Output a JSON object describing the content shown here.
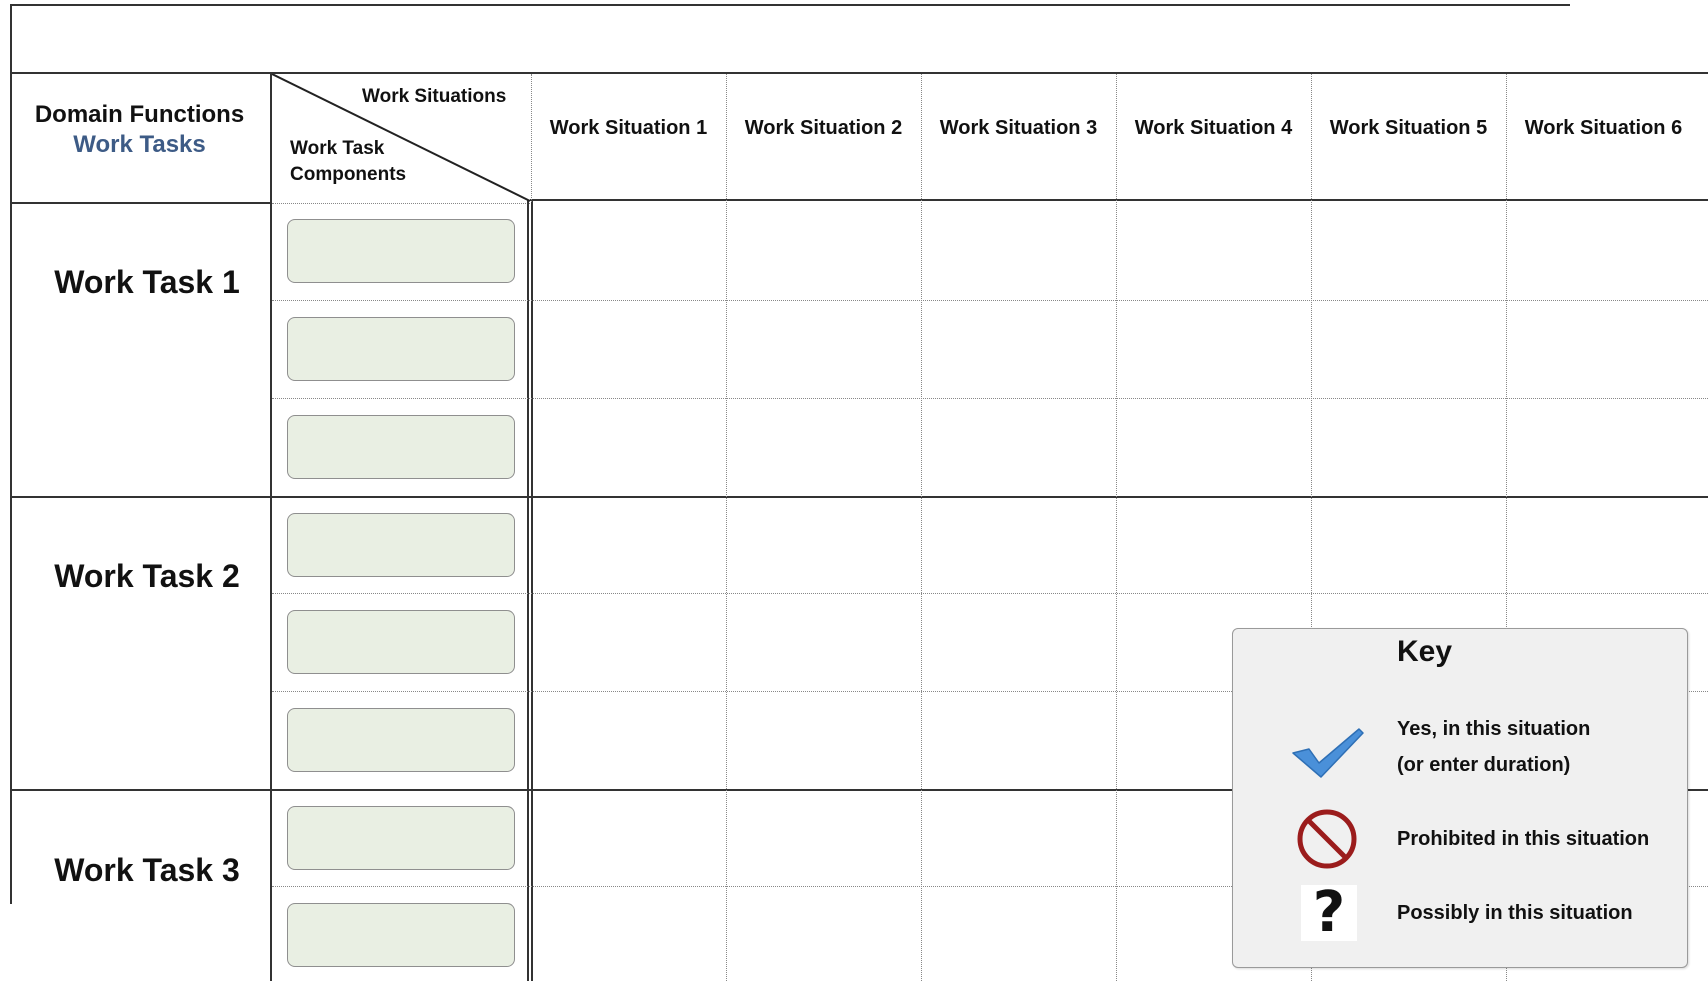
{
  "header": {
    "domain_functions": "Domain Functions",
    "work_tasks": "Work Tasks",
    "work_situations": "Work Situations",
    "work_task_components_line1": "Work Task",
    "work_task_components_line2": "Components"
  },
  "columns": [
    "Work Situation 1",
    "Work Situation 2",
    "Work Situation 3",
    "Work Situation 4",
    "Work Situation 5",
    "Work Situation 6"
  ],
  "tasks": [
    "Work Task 1",
    "Work Task 2",
    "Work Task 3"
  ],
  "key": {
    "title": "Key",
    "yes_line1": "Yes, in this situation",
    "yes_line2": "(or enter duration)",
    "prohibited": "Prohibited in this situation",
    "possibly": "Possibly in this situation",
    "icons": [
      "check-icon",
      "prohibited-icon",
      "question-icon"
    ],
    "colors": {
      "check": "#4a90d9",
      "prohibited": "#9b1c1c",
      "task_blue": "#3d5b86",
      "component_fill": "#e9efe3"
    }
  }
}
